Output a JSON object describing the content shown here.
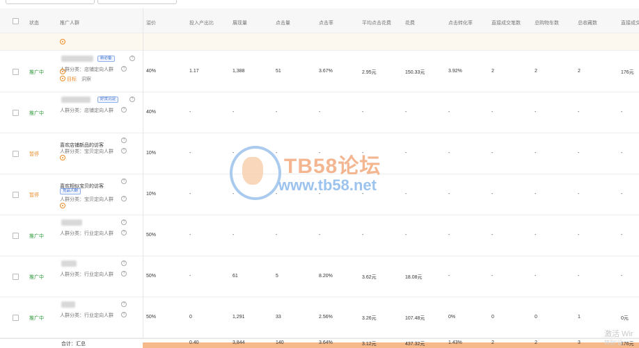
{
  "header": {
    "status": "状态",
    "audience": "推广人群",
    "bid": "溢价",
    "cols": [
      "投入产出比",
      "展现量",
      "点击量",
      "点击率",
      "平均点击花费",
      "花费",
      "点击转化率",
      "直接成交笔数",
      "总购物车数",
      "总收藏数",
      "直接成交"
    ]
  },
  "rows": [
    {
      "status": "推广中",
      "status_type": "on",
      "name": "",
      "tag": "新必备",
      "category": "人群分类：店铺定向人群",
      "bid": "40%",
      "extra": "目标",
      "extra2": "洞察",
      "cells": [
        "1.17",
        "1,388",
        "51",
        "3.67%",
        "2.95元",
        "150.33元",
        "3.92%",
        "2",
        "2",
        "2",
        "176元"
      ]
    },
    {
      "status": "推广中",
      "status_type": "on",
      "name": "",
      "tag": "好货沉淀",
      "category": "人群分类：店铺定向人群",
      "bid": "40%",
      "cells": [
        "-",
        "-",
        "-",
        "-",
        "-",
        "-",
        "-",
        "-",
        "-",
        "-",
        "-"
      ]
    },
    {
      "status": "暂停",
      "status_type": "off",
      "name": "喜欢店铺新品的访客",
      "tag": "",
      "category": "人群分类：宝贝定向人群",
      "bid": "10%",
      "cells": [
        "-",
        "-",
        "-",
        "-",
        "-",
        "-",
        "-",
        "-",
        "-",
        "-",
        "-"
      ]
    },
    {
      "status": "暂停",
      "status_type": "off",
      "name": "喜欢相似宝贝的访客",
      "tag": "竞品人群",
      "category": "人群分类：宝贝定向人群",
      "bid": "10%",
      "cells": [
        "-",
        "-",
        "-",
        "-",
        "-",
        "-",
        "-",
        "-",
        "-",
        "-",
        "-"
      ]
    },
    {
      "status": "推广中",
      "status_type": "on",
      "name": "",
      "tag": "",
      "category": "人群分类：行业定向人群",
      "bid": "50%",
      "cells": [
        "-",
        "-",
        "-",
        "-",
        "-",
        "-",
        "-",
        "-",
        "-",
        "-",
        "-"
      ]
    },
    {
      "status": "推广中",
      "status_type": "on",
      "name": "",
      "tag": "",
      "category": "人群分类：行业定向人群",
      "bid": "50%",
      "cells": [
        "-",
        "61",
        "5",
        "8.20%",
        "3.62元",
        "18.08元",
        "-",
        "-",
        "-",
        "-",
        "-"
      ]
    },
    {
      "status": "推广中",
      "status_type": "on",
      "name": "",
      "tag": "",
      "category": "人群分类：行业定向人群",
      "bid": "50%",
      "cells": [
        "0",
        "1,291",
        "33",
        "2.56%",
        "3.26元",
        "107.48元",
        "0%",
        "0",
        "0",
        "1",
        "0元"
      ]
    }
  ],
  "footer": {
    "label": "合计：汇总",
    "cells": [
      "0.40",
      "3,844",
      "140",
      "3.64%",
      "3.12元",
      "437.32元",
      "1.43%",
      "2",
      "2",
      "3",
      "176元"
    ]
  },
  "watermark": {
    "title": "TB58论坛",
    "url": "www.tb58.net"
  },
  "os_notice": {
    "line1": "激活 Wir",
    "line2": "转到\"设"
  },
  "colors": {
    "on": "#2e9b3a",
    "off": "#e88a24",
    "tag_blue": "#3d6fcf",
    "target": "#f08a24"
  }
}
